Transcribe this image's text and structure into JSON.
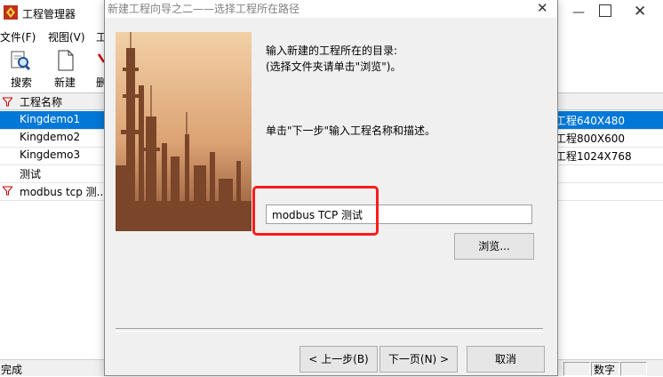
{
  "background_window": {
    "title": "工程管理器",
    "menu": [
      "文件(F)",
      "视图(V)",
      "工"
    ],
    "toolbar": {
      "search": "搜索",
      "new": "新建",
      "delete": "删"
    },
    "list_header": "工程名称",
    "rows": [
      {
        "name": "Kingdemo1",
        "desc": "工程640X480",
        "selected": true
      },
      {
        "name": "Kingdemo2",
        "desc": "工程800X600",
        "selected": false
      },
      {
        "name": "Kingdemo3",
        "desc": "工程1024X768",
        "selected": false
      },
      {
        "name": "测试",
        "desc": "",
        "selected": false
      },
      {
        "name": "modbus tcp 测...",
        "desc": "",
        "selected": false
      }
    ],
    "status_left": "完成",
    "status_right": "数字"
  },
  "dialog": {
    "title": "新建工程向导之二——选择工程所在路径",
    "instruction_line1": "输入新建的工程所在的目录:",
    "instruction_line2": "(选择文件夹请单击\"浏览\")。",
    "next_hint": "单击\"下一步\"输入工程名称和描述。",
    "path_value": "modbus TCP 测试",
    "browse_label": "浏览...",
    "back_label": "< 上一步(B)",
    "next_label": "下一页(N) >",
    "cancel_label": "取消"
  },
  "colors": {
    "selection": "#0078d7",
    "highlight": "#ff1a1a"
  }
}
